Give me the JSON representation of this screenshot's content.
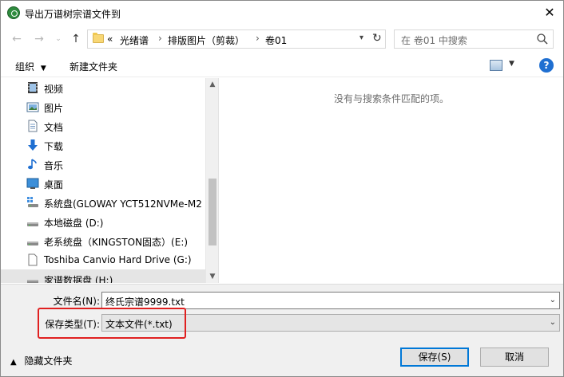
{
  "window": {
    "title": "导出万谱树宗谱文件到"
  },
  "address": {
    "overflow": "«",
    "crumbs": [
      "光绪谱",
      "排版图片（剪裁）",
      "卷01"
    ]
  },
  "search": {
    "placeholder": "在 卷01 中搜索"
  },
  "toolbar": {
    "organize": "组织",
    "new_folder": "新建文件夹"
  },
  "nav": {
    "items": [
      {
        "label": "视频",
        "icon": "video-icon"
      },
      {
        "label": "图片",
        "icon": "pictures-icon"
      },
      {
        "label": "文档",
        "icon": "documents-icon"
      },
      {
        "label": "下载",
        "icon": "download-icon"
      },
      {
        "label": "音乐",
        "icon": "music-icon"
      },
      {
        "label": "桌面",
        "icon": "desktop-icon"
      },
      {
        "label": "系统盘(GLOWAY YCT512NVMe-M2",
        "icon": "system-drive-icon"
      },
      {
        "label": "本地磁盘 (D:)",
        "icon": "drive-icon"
      },
      {
        "label": "老系统盘（KINGSTON固态）(E:)",
        "icon": "drive-icon"
      },
      {
        "label": "Toshiba Canvio Hard Drive (G:)",
        "icon": "file-icon"
      },
      {
        "label": "家谱数据盘 (H:)",
        "icon": "drive-icon"
      }
    ]
  },
  "content": {
    "empty_message": "没有与搜索条件匹配的项。"
  },
  "form": {
    "filename_label": "文件名(N):",
    "filename_value": "终氏宗谱9999.txt",
    "filetype_label": "保存类型(T):",
    "filetype_value": "文本文件(*.txt)"
  },
  "footer": {
    "hide_folders": "隐藏文件夹",
    "save": "保存(S)",
    "cancel": "取消"
  },
  "colors": {
    "highlight_frame": "#e02020",
    "accent": "#0078d7"
  }
}
